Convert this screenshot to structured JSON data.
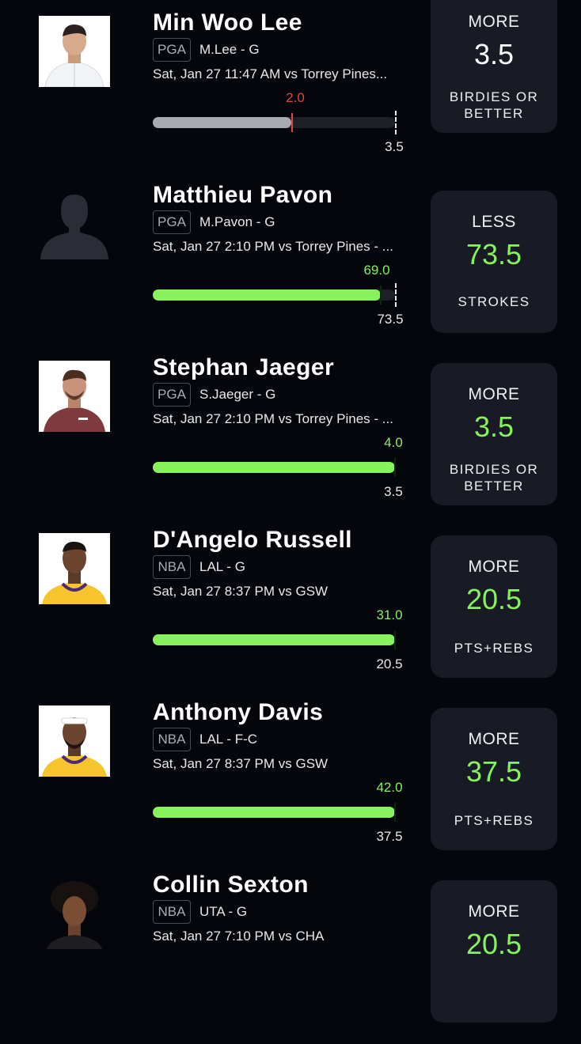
{
  "colors": {
    "accent_green": "#86f25c",
    "miss_red": "#e2463f",
    "card_bg": "#181b24",
    "page_bg": "#04060c"
  },
  "players": [
    {
      "name": "Min Woo Lee",
      "league": "PGA",
      "team": "M.Lee - G",
      "game": "Sat, Jan 27 11:47 AM  vs Torrey Pines...",
      "result_value": "2.0",
      "line_value": "3.5",
      "progress_fraction": 0.571,
      "status": "miss",
      "pick_direction": "MORE",
      "pick_line": "3.5",
      "pick_stat": "BIRDIES OR BETTER",
      "avatar": "golfer-white-shirt-photo"
    },
    {
      "name": "Matthieu Pavon",
      "league": "PGA",
      "team": "M.Pavon - G",
      "game": "Sat, Jan 27 2:10 PM  vs Torrey Pines - ...",
      "result_value": "69.0",
      "line_value": "73.5",
      "progress_fraction": 0.939,
      "status": "hit",
      "pick_direction": "LESS",
      "pick_line": "73.5",
      "pick_stat": "STROKES",
      "avatar": "silhouette-placeholder"
    },
    {
      "name": "Stephan Jaeger",
      "league": "PGA",
      "team": "S.Jaeger - G",
      "game": "Sat, Jan 27 2:10 PM  vs Torrey Pines - ...",
      "result_value": "4.0",
      "line_value": "3.5",
      "progress_fraction": 1.0,
      "status": "hit",
      "pick_direction": "MORE",
      "pick_line": "3.5",
      "pick_stat": "BIRDIES OR BETTER",
      "avatar": "golfer-maroon-shirt-photo"
    },
    {
      "name": "D'Angelo Russell",
      "league": "NBA",
      "team": "LAL - G",
      "game": "Sat, Jan 27 8:37 PM  vs GSW",
      "result_value": "31.0",
      "line_value": "20.5",
      "progress_fraction": 1.0,
      "status": "hit",
      "pick_direction": "MORE",
      "pick_line": "20.5",
      "pick_stat": "PTS+REBS",
      "avatar": "lakers-player-photo"
    },
    {
      "name": "Anthony Davis",
      "league": "NBA",
      "team": "LAL - F-C",
      "game": "Sat, Jan 27 8:37 PM  vs GSW",
      "result_value": "42.0",
      "line_value": "37.5",
      "progress_fraction": 1.0,
      "status": "hit",
      "pick_direction": "MORE",
      "pick_line": "37.5",
      "pick_stat": "PTS+REBS",
      "avatar": "lakers-player-headband-photo"
    },
    {
      "name": "Collin Sexton",
      "league": "NBA",
      "team": "UTA - G",
      "game": "Sat, Jan 27 7:10 PM  vs CHA",
      "pick_direction": "MORE",
      "pick_line": "20.5",
      "avatar": "jazz-player-photo"
    }
  ]
}
